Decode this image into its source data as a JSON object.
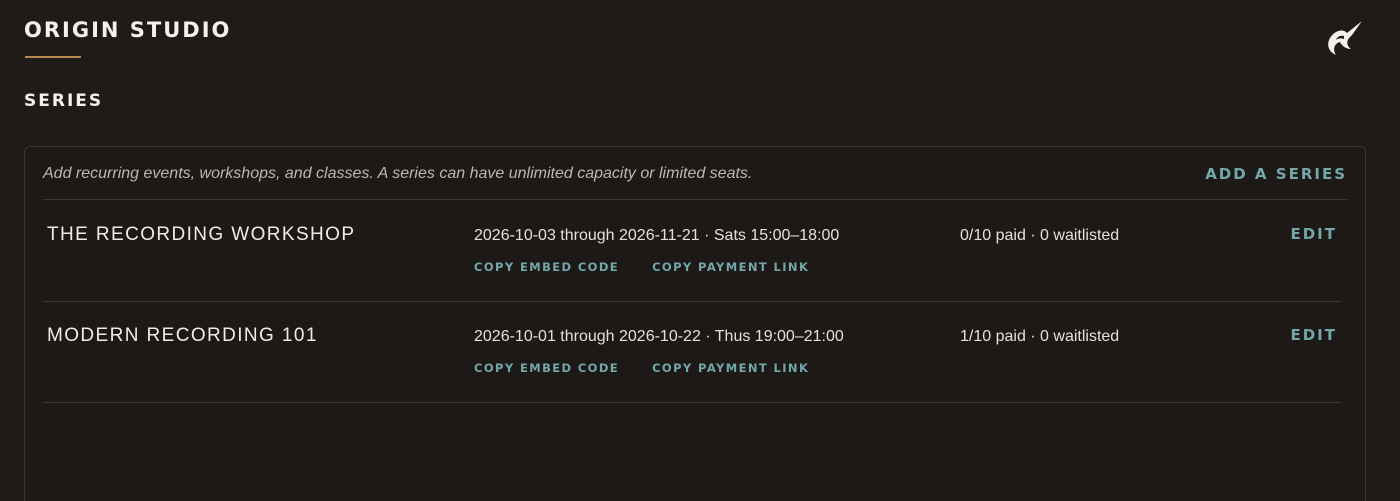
{
  "brand": {
    "name": "ORIGIN STUDIO",
    "logo_icon": "narwhal-icon"
  },
  "section": {
    "title": "SERIES"
  },
  "panel": {
    "description": "Add recurring events, workshops, and classes. A series can have unlimited capacity or limited seats.",
    "add_label": "ADD A SERIES"
  },
  "series": [
    {
      "name": "THE RECORDING WORKSHOP",
      "schedule": "2026-10-03 through 2026-11-21 · Sats 15:00–18:00",
      "status": "0/10 paid · 0 waitlisted",
      "copy_embed_label": "COPY EMBED CODE",
      "copy_payment_label": "COPY PAYMENT LINK",
      "edit_label": "EDIT"
    },
    {
      "name": "MODERN RECORDING 101",
      "schedule": "2026-10-01 through 2026-10-22 · Thus 19:00–21:00",
      "status": "1/10 paid · 0 waitlisted",
      "copy_embed_label": "COPY EMBED CODE",
      "copy_payment_label": "COPY PAYMENT LINK",
      "edit_label": "EDIT"
    }
  ],
  "colors": {
    "background": "#1e1b18",
    "accent": "#73a7aa",
    "brand_underline": "#b58a52"
  }
}
